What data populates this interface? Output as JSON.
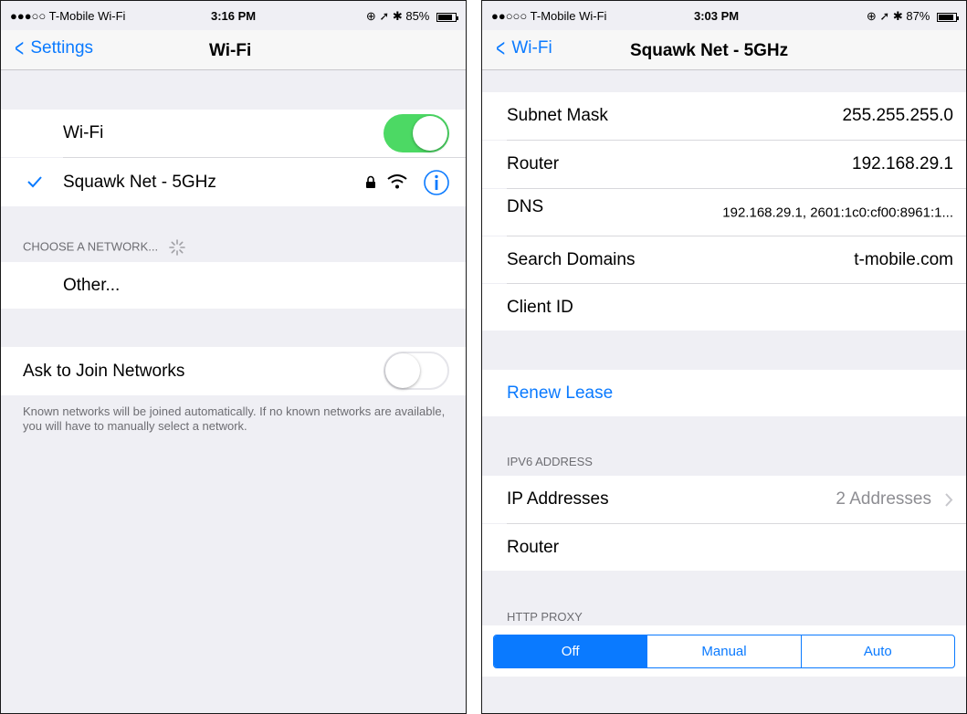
{
  "left": {
    "status": {
      "carrier": "●●●○○ T-Mobile Wi-Fi",
      "time": "3:16 PM",
      "icons": "⊕ ➚ ✱",
      "battery": "85%",
      "battery_level": 0.85
    },
    "nav": {
      "back": "Settings",
      "title": "Wi-Fi"
    },
    "wifi_label": "Wi-Fi",
    "wifi_on": true,
    "connected_network": "Squawk Net - 5GHz",
    "choose_header": "CHOOSE A NETWORK...",
    "other_label": "Other...",
    "ask_label": "Ask to Join Networks",
    "ask_on": false,
    "ask_footer": "Known networks will be joined automatically. If no known networks are available, you will have to manually select a network."
  },
  "right": {
    "status": {
      "carrier": "●●○○○ T-Mobile Wi-Fi",
      "time": "3:03 PM",
      "icons": "⊕ ➚ ✱",
      "battery": "87%",
      "battery_level": 0.87
    },
    "nav": {
      "back": "Wi-Fi",
      "title": "Squawk Net - 5GHz"
    },
    "rows": [
      {
        "label": "Subnet Mask",
        "value": "255.255.255.0"
      },
      {
        "label": "Router",
        "value": "192.168.29.1"
      },
      {
        "label": "DNS",
        "value": "192.168.29.1, 2601:1c0:cf00:8961:1..."
      },
      {
        "label": "Search Domains",
        "value": "t-mobile.com"
      },
      {
        "label": "Client ID",
        "value": ""
      }
    ],
    "renew": "Renew Lease",
    "ipv6_header": "IPV6 ADDRESS",
    "ipv6_rows": [
      {
        "label": "IP Addresses",
        "value": "2 Addresses"
      },
      {
        "label": "Router",
        "value": ""
      }
    ],
    "proxy_header": "HTTP PROXY",
    "proxy_options": [
      "Off",
      "Manual",
      "Auto"
    ],
    "proxy_selected": "Off"
  },
  "colors": {
    "accent": "#0a7aff",
    "toggle_on": "#4cd964",
    "group_bg": "#efeff4"
  }
}
